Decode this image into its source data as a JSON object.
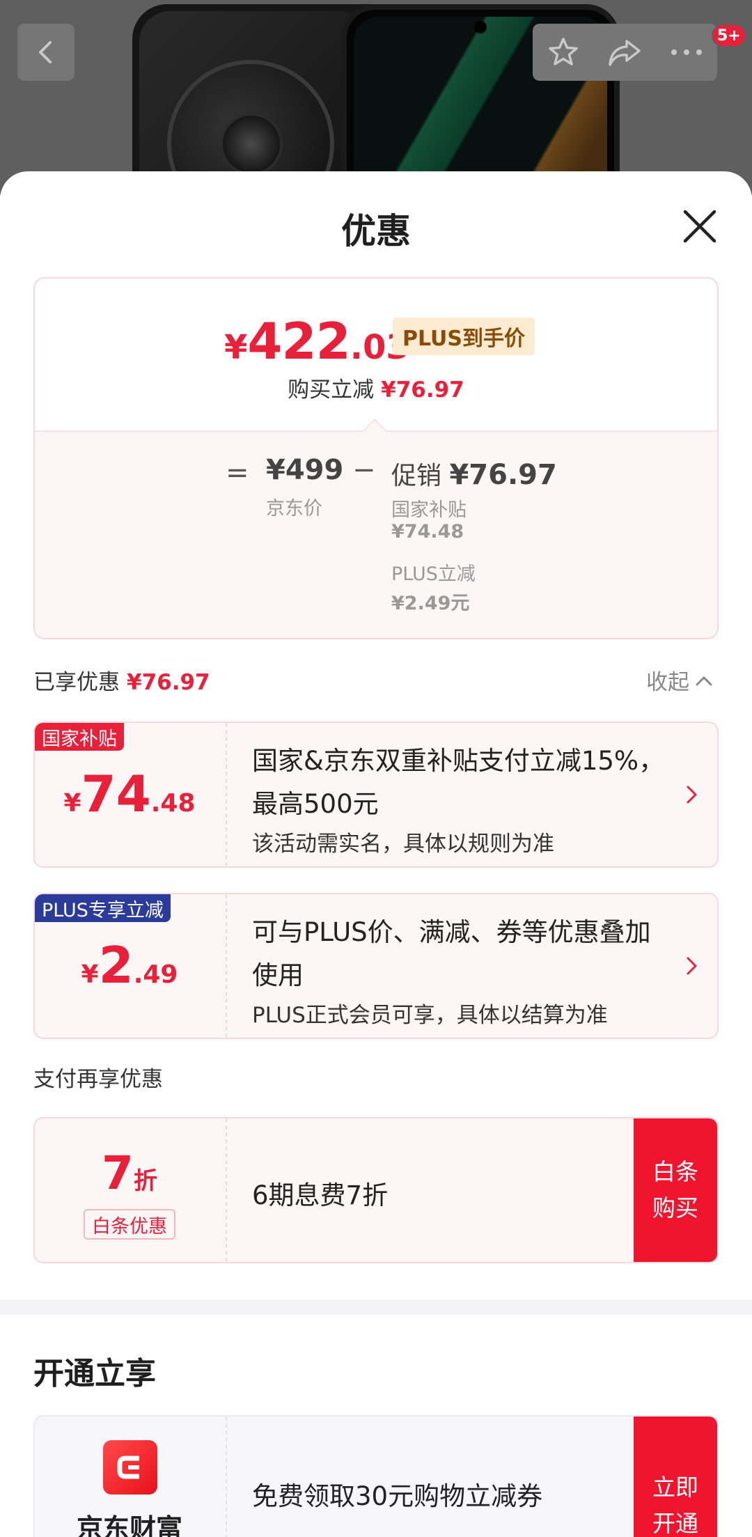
{
  "header": {
    "cart_badge": "5+",
    "icons": {
      "back": "chevron-left-icon",
      "favorite": "star-icon",
      "share": "share-icon",
      "more": "more-dots-icon"
    }
  },
  "sheet": {
    "title": "优惠",
    "summary": {
      "final_symbol": "¥",
      "final_int": "422",
      "final_dec": ".03",
      "plus_label": "PLUS到手价",
      "reduce_label": "购买立减",
      "reduce_value": "¥76.97",
      "equals": "=",
      "jd_price": "¥499",
      "jd_price_label": "京东价",
      "minus": "−",
      "promo_label": "促销",
      "promo_value": "¥76.97",
      "items": [
        {
          "label": "国家补贴",
          "value": "¥74.48"
        },
        {
          "label": "PLUS立减",
          "value": "¥2.49元"
        }
      ]
    },
    "enjoyed_label": "已享优惠",
    "enjoyed_value": "¥76.97",
    "collapse_label": "收起",
    "promotions": [
      {
        "tag": "国家补贴",
        "symbol": "¥",
        "int": "74",
        "dec": ".48",
        "line1": "国家&京东双重补贴支付立减15%，最高500元",
        "line2": "该活动需实名，具体以规则为准"
      },
      {
        "tag": "PLUS专享立减",
        "symbol": "¥",
        "int": "2",
        "dec": ".49",
        "line1": "可与PLUS价、满减、券等优惠叠加使用",
        "line2": "PLUS正式会员可享，具体以结算为准"
      }
    ],
    "pay_title": "支付再享优惠",
    "pay": {
      "discount_num": "7",
      "discount_unit": "折",
      "tag": "白条优惠",
      "text": "6期息费7折",
      "button": "白条购买"
    },
    "open_title": "开通立享",
    "open": {
      "brand": "京东财富",
      "text": "免费领取30元购物立减券",
      "button": "立即开通"
    }
  },
  "colors": {
    "accent": "#e9203a",
    "button": "#f0142e",
    "plus_tag_bg": "#fcebd0",
    "national_tag": "#e9203a",
    "plus_member_tag": "#2a3b9c"
  }
}
